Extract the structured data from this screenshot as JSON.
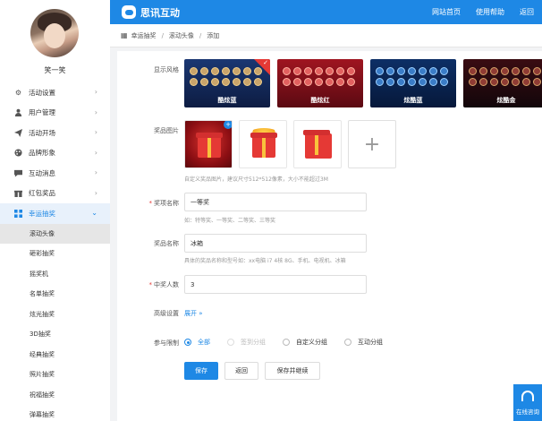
{
  "app": {
    "brand": "思讯互动"
  },
  "topnav": [
    "网站首页",
    "使用帮助",
    "返回"
  ],
  "user": {
    "name": "笑一笑"
  },
  "sidebar": {
    "items": [
      {
        "label": "活动设置",
        "icon": "gear-icon"
      },
      {
        "label": "用户管理",
        "icon": "user-icon"
      },
      {
        "label": "活动开场",
        "icon": "send-icon"
      },
      {
        "label": "品牌形象",
        "icon": "palette-icon"
      },
      {
        "label": "互动消息",
        "icon": "message-icon"
      },
      {
        "label": "红包奖品",
        "icon": "gift-icon"
      },
      {
        "label": "幸运抽奖",
        "icon": "lottery-icon"
      }
    ],
    "subitems": [
      "滚动头像",
      "砸彩抽奖",
      "摇奖机",
      "名单抽奖",
      "炫光抽奖",
      "3D抽奖",
      "经典抽奖",
      "照片抽奖",
      "祝福抽奖",
      "弹幕抽奖"
    ]
  },
  "breadcrumb": [
    "幸运抽奖",
    "滚动头像",
    "添加"
  ],
  "form": {
    "style_label": "显示风格",
    "themes": [
      "酷炫蓝",
      "酷炫红",
      "炫酷蓝",
      "炫酷金"
    ],
    "prize_image_label": "奖品图片",
    "prize_image_hint": "自定义奖品图片，建议尺寸512*512像素，大小不能超过3M",
    "item_name_label": "奖项名称",
    "item_name_value": "一等奖",
    "item_name_hint": "如：特等奖、一等奖、二等奖、三等奖",
    "prize_name_label": "奖品名称",
    "prize_name_value": "冰箱",
    "prize_name_hint": "具体的奖品名称和型号如：xx电脑 i7 4核 8G、手机、电视机、冰箱",
    "winners_label": "中奖人数",
    "winners_value": "3",
    "advanced_label": "高级设置",
    "advanced_toggle": "展开 »",
    "limit_label": "参与限制",
    "limit_options": [
      "全部",
      "签到分组",
      "自定义分组",
      "互动分组"
    ],
    "buttons": {
      "save": "保存",
      "back": "返回",
      "save_continue": "保存并继续"
    }
  },
  "support": {
    "label": "在线咨询"
  },
  "colors": {
    "primary": "#1e88e5",
    "required": "#e53935"
  }
}
